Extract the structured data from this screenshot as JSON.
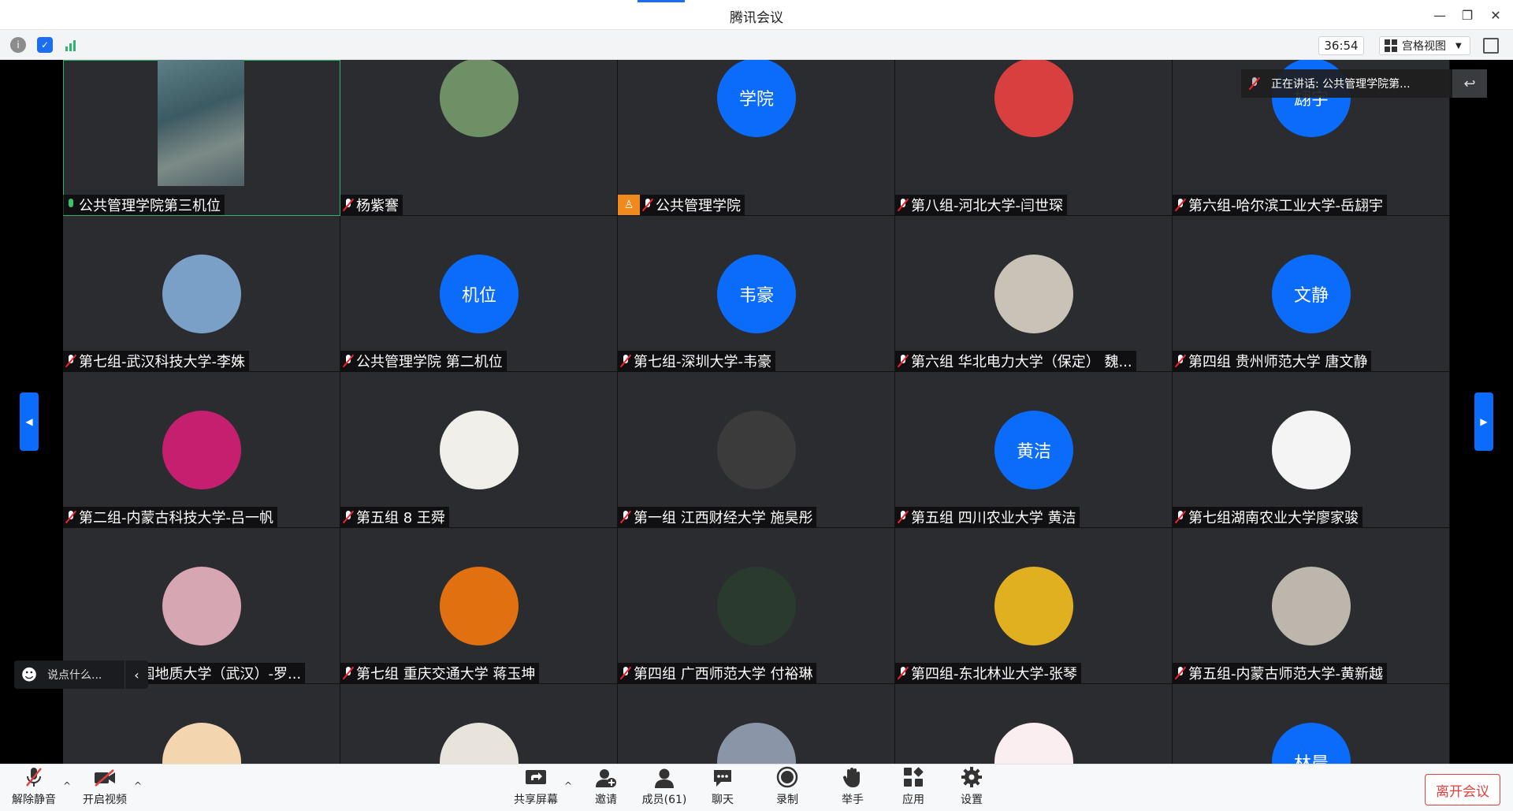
{
  "window": {
    "title": "腾讯会议"
  },
  "infobar": {
    "timer": "36:54",
    "view_label": "宫格视图"
  },
  "speaking": {
    "text": "正在讲话: 公共管理学院第..."
  },
  "chat": {
    "placeholder": "说点什么..."
  },
  "tiles": [
    {
      "name": "公共管理学院第三机位",
      "type": "photo",
      "mic": "on",
      "active": true
    },
    {
      "name": "杨紫謇",
      "type": "image",
      "bg": "#6f8f66",
      "mic": "muted"
    },
    {
      "name": "公共管理学院",
      "type": "text",
      "label": "学院",
      "mic": "muted",
      "host": true
    },
    {
      "name": "第八组-河北大学-闫世琛",
      "type": "image",
      "bg": "#d84040",
      "mic": "muted"
    },
    {
      "name": "第六组-哈尔滨工业大学-岳翃宇",
      "type": "text",
      "label": "翃宇",
      "mic": "muted"
    },
    {
      "name": "第七组-武汉科技大学-李姝",
      "type": "image",
      "bg": "#7aa0c8",
      "mic": "muted"
    },
    {
      "name": "公共管理学院 第二机位",
      "type": "text",
      "label": "机位",
      "mic": "muted"
    },
    {
      "name": "第七组-深圳大学-韦豪",
      "type": "text",
      "label": "韦豪",
      "mic": "muted"
    },
    {
      "name": "第六组 华北电力大学（保定） 魏...",
      "type": "image",
      "bg": "#c9c2b6",
      "mic": "muted"
    },
    {
      "name": "第四组 贵州师范大学 唐文静",
      "type": "text",
      "label": "文静",
      "mic": "muted"
    },
    {
      "name": "第二组-内蒙古科技大学-吕一帆",
      "type": "image",
      "bg": "#c4206f",
      "mic": "muted"
    },
    {
      "name": "第五组 8 王舜",
      "type": "image",
      "bg": "#f1efe9",
      "mic": "muted"
    },
    {
      "name": "第一组 江西财经大学 施昊彤",
      "type": "image",
      "bg": "#3b3b3b",
      "mic": "muted"
    },
    {
      "name": "第五组 四川农业大学  黄洁",
      "type": "text",
      "label": "黄洁",
      "mic": "muted"
    },
    {
      "name": "第七组湖南农业大学廖家骏",
      "type": "image",
      "bg": "#f4f4f4",
      "mic": "muted"
    },
    {
      "name": "第四组-中国地质大学（武汉）-罗...",
      "type": "image",
      "bg": "#d7a6b3",
      "mic": "muted"
    },
    {
      "name": "第七组 重庆交通大学 蒋玉坤",
      "type": "image",
      "bg": "#e07010",
      "mic": "muted"
    },
    {
      "name": "第四组 广西师范大学 付裕琳",
      "type": "image",
      "bg": "#2b3a2e",
      "mic": "muted"
    },
    {
      "name": "第四组-东北林业大学-张琴",
      "type": "image",
      "bg": "#e0b020",
      "mic": "muted"
    },
    {
      "name": "第五组-内蒙古师范大学-黄新越",
      "type": "image",
      "bg": "#bcb6ac",
      "mic": "muted"
    },
    {
      "name": "",
      "type": "image",
      "bg": "#f3d6b0"
    },
    {
      "name": "",
      "type": "image",
      "bg": "#e8e4dc"
    },
    {
      "name": "",
      "type": "image",
      "bg": "#8a95a8"
    },
    {
      "name": "",
      "type": "image",
      "bg": "#fbeef0"
    },
    {
      "name": "",
      "type": "text",
      "label": "林晨"
    }
  ],
  "toolbar": {
    "unmute": "解除静音",
    "video": "开启视频",
    "share": "共享屏幕",
    "invite": "邀请",
    "members": "成员(61)",
    "chat": "聊天",
    "record": "录制",
    "raise": "举手",
    "apps": "应用",
    "settings": "设置",
    "leave": "离开会议"
  }
}
